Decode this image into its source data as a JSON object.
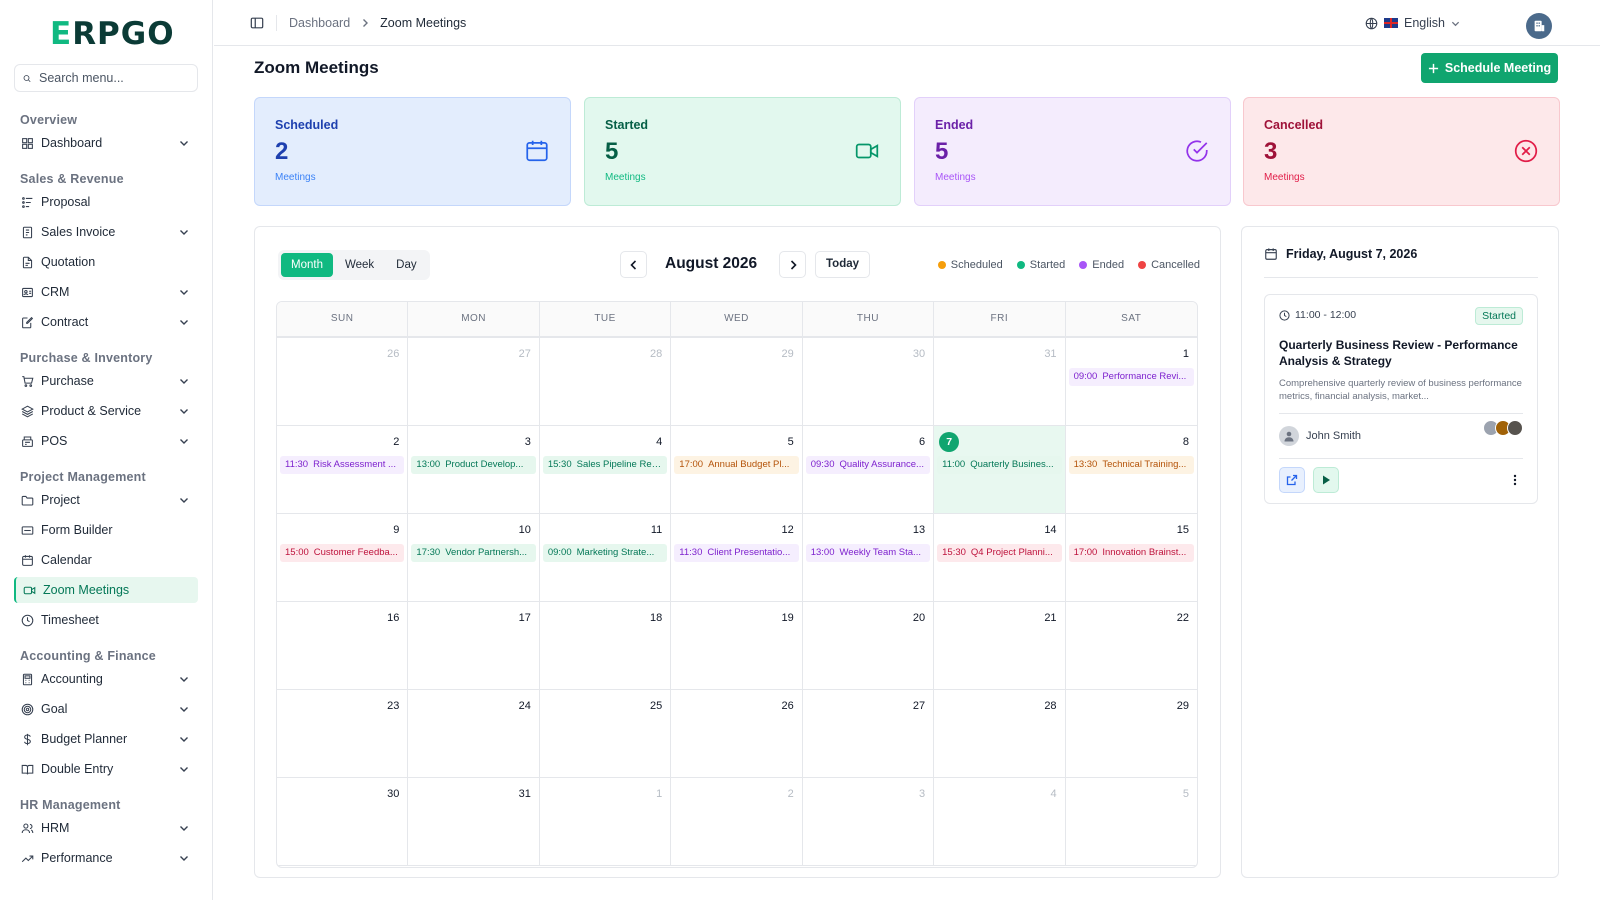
{
  "app": {
    "logo_prefix": "E",
    "logo_rest": "RPGO"
  },
  "sidebar": {
    "search_placeholder": "Search menu...",
    "sections": [
      {
        "title": "Overview",
        "items": [
          {
            "label": "Dashboard",
            "icon": "grid-icon",
            "chevron": true
          }
        ]
      },
      {
        "title": "Sales & Revenue",
        "items": [
          {
            "label": "Proposal",
            "icon": "proposal-icon",
            "chevron": false
          },
          {
            "label": "Sales Invoice",
            "icon": "invoice-icon",
            "chevron": true
          },
          {
            "label": "Quotation",
            "icon": "document-icon",
            "chevron": false
          },
          {
            "label": "CRM",
            "icon": "crm-icon",
            "chevron": true
          },
          {
            "label": "Contract",
            "icon": "contract-icon",
            "chevron": true
          }
        ]
      },
      {
        "title": "Purchase & Inventory",
        "items": [
          {
            "label": "Purchase",
            "icon": "cart-icon",
            "chevron": true
          },
          {
            "label": "Product & Service",
            "icon": "layers-icon",
            "chevron": true
          },
          {
            "label": "POS",
            "icon": "pos-icon",
            "chevron": true
          }
        ]
      },
      {
        "title": "Project Management",
        "items": [
          {
            "label": "Project",
            "icon": "folder-icon",
            "chevron": true
          },
          {
            "label": "Form Builder",
            "icon": "form-icon",
            "chevron": false
          },
          {
            "label": "Calendar",
            "icon": "calendar-icon",
            "chevron": false
          },
          {
            "label": "Zoom Meetings",
            "icon": "video-icon",
            "chevron": false,
            "active": true
          },
          {
            "label": "Timesheet",
            "icon": "clock-icon",
            "chevron": false
          }
        ]
      },
      {
        "title": "Accounting & Finance",
        "items": [
          {
            "label": "Accounting",
            "icon": "calculator-icon",
            "chevron": true
          },
          {
            "label": "Goal",
            "icon": "target-icon",
            "chevron": true
          },
          {
            "label": "Budget Planner",
            "icon": "dollar-icon",
            "chevron": true
          },
          {
            "label": "Double Entry",
            "icon": "book-icon",
            "chevron": true
          }
        ]
      },
      {
        "title": "HR Management",
        "items": [
          {
            "label": "HRM",
            "icon": "users-icon",
            "chevron": true
          },
          {
            "label": "Performance",
            "icon": "trend-icon",
            "chevron": true
          }
        ]
      }
    ]
  },
  "topbar": {
    "breadcrumb": [
      "Dashboard",
      "Zoom Meetings"
    ],
    "language": "English"
  },
  "page": {
    "title": "Zoom Meetings",
    "primary_button": "Schedule Meeting"
  },
  "stats": [
    {
      "key": "scheduled",
      "label": "Scheduled",
      "value": "2",
      "sub": "Meetings",
      "icon": "calendar-icon"
    },
    {
      "key": "started",
      "label": "Started",
      "value": "5",
      "sub": "Meetings",
      "icon": "video-icon"
    },
    {
      "key": "ended",
      "label": "Ended",
      "value": "5",
      "sub": "Meetings",
      "icon": "check-circle-icon"
    },
    {
      "key": "cancelled",
      "label": "Cancelled",
      "value": "3",
      "sub": "Meetings",
      "icon": "x-circle-icon"
    }
  ],
  "calendar": {
    "views": [
      "Month",
      "Week",
      "Day"
    ],
    "active_view": "Month",
    "month_title": "August 2026",
    "today_label": "Today",
    "legend": [
      {
        "label": "Scheduled",
        "color": "#f59e0b"
      },
      {
        "label": "Started",
        "color": "#10b981"
      },
      {
        "label": "Ended",
        "color": "#a855f7"
      },
      {
        "label": "Cancelled",
        "color": "#ef4444"
      }
    ],
    "weekdays": [
      "SUN",
      "MON",
      "TUE",
      "WED",
      "THU",
      "FRI",
      "SAT"
    ],
    "days": [
      {
        "num": "26",
        "muted": true
      },
      {
        "num": "27",
        "muted": true
      },
      {
        "num": "28",
        "muted": true
      },
      {
        "num": "29",
        "muted": true
      },
      {
        "num": "30",
        "muted": true
      },
      {
        "num": "31",
        "muted": true
      },
      {
        "num": "1",
        "event": {
          "time": "09:00",
          "title": "Performance Revi...",
          "color": "purple"
        }
      },
      {
        "num": "2",
        "event": {
          "time": "11:30",
          "title": "Risk Assessment ...",
          "color": "purple"
        }
      },
      {
        "num": "3",
        "event": {
          "time": "13:00",
          "title": "Product Develop...",
          "color": "green"
        }
      },
      {
        "num": "4",
        "event": {
          "time": "15:30",
          "title": "Sales Pipeline Rev...",
          "color": "green"
        }
      },
      {
        "num": "5",
        "event": {
          "time": "17:00",
          "title": "Annual Budget Pl...",
          "color": "orange"
        }
      },
      {
        "num": "6",
        "event": {
          "time": "09:30",
          "title": "Quality Assurance...",
          "color": "purple"
        }
      },
      {
        "num": "7",
        "today": true,
        "event": {
          "time": "11:00",
          "title": "Quarterly Busines...",
          "color": "green"
        }
      },
      {
        "num": "8",
        "event": {
          "time": "13:30",
          "title": "Technical Training...",
          "color": "orange"
        }
      },
      {
        "num": "9",
        "event": {
          "time": "15:00",
          "title": "Customer Feedba...",
          "color": "red"
        }
      },
      {
        "num": "10",
        "event": {
          "time": "17:30",
          "title": "Vendor Partnersh...",
          "color": "green"
        }
      },
      {
        "num": "11",
        "event": {
          "time": "09:00",
          "title": "Marketing Strate...",
          "color": "green"
        }
      },
      {
        "num": "12",
        "event": {
          "time": "11:30",
          "title": "Client Presentatio...",
          "color": "purple"
        }
      },
      {
        "num": "13",
        "event": {
          "time": "13:00",
          "title": "Weekly Team Sta...",
          "color": "purple"
        }
      },
      {
        "num": "14",
        "event": {
          "time": "15:30",
          "title": "Q4 Project Planni...",
          "color": "red"
        }
      },
      {
        "num": "15",
        "event": {
          "time": "17:00",
          "title": "Innovation Brainst...",
          "color": "red"
        }
      },
      {
        "num": "16"
      },
      {
        "num": "17"
      },
      {
        "num": "18"
      },
      {
        "num": "19"
      },
      {
        "num": "20"
      },
      {
        "num": "21"
      },
      {
        "num": "22"
      },
      {
        "num": "23"
      },
      {
        "num": "24"
      },
      {
        "num": "25"
      },
      {
        "num": "26"
      },
      {
        "num": "27"
      },
      {
        "num": "28"
      },
      {
        "num": "29"
      },
      {
        "num": "30"
      },
      {
        "num": "31"
      },
      {
        "num": "1",
        "muted": true
      },
      {
        "num": "2",
        "muted": true
      },
      {
        "num": "3",
        "muted": true
      },
      {
        "num": "4",
        "muted": true
      },
      {
        "num": "5",
        "muted": true
      }
    ]
  },
  "side_panel": {
    "date": "Friday, August 7, 2026",
    "meeting": {
      "time": "11:00 - 12:00",
      "status": "Started",
      "title": "Quarterly Business Review - Performance Analysis & Strategy",
      "description": "Comprehensive quarterly review of business performance metrics, financial analysis, market...",
      "host": "John Smith"
    }
  }
}
